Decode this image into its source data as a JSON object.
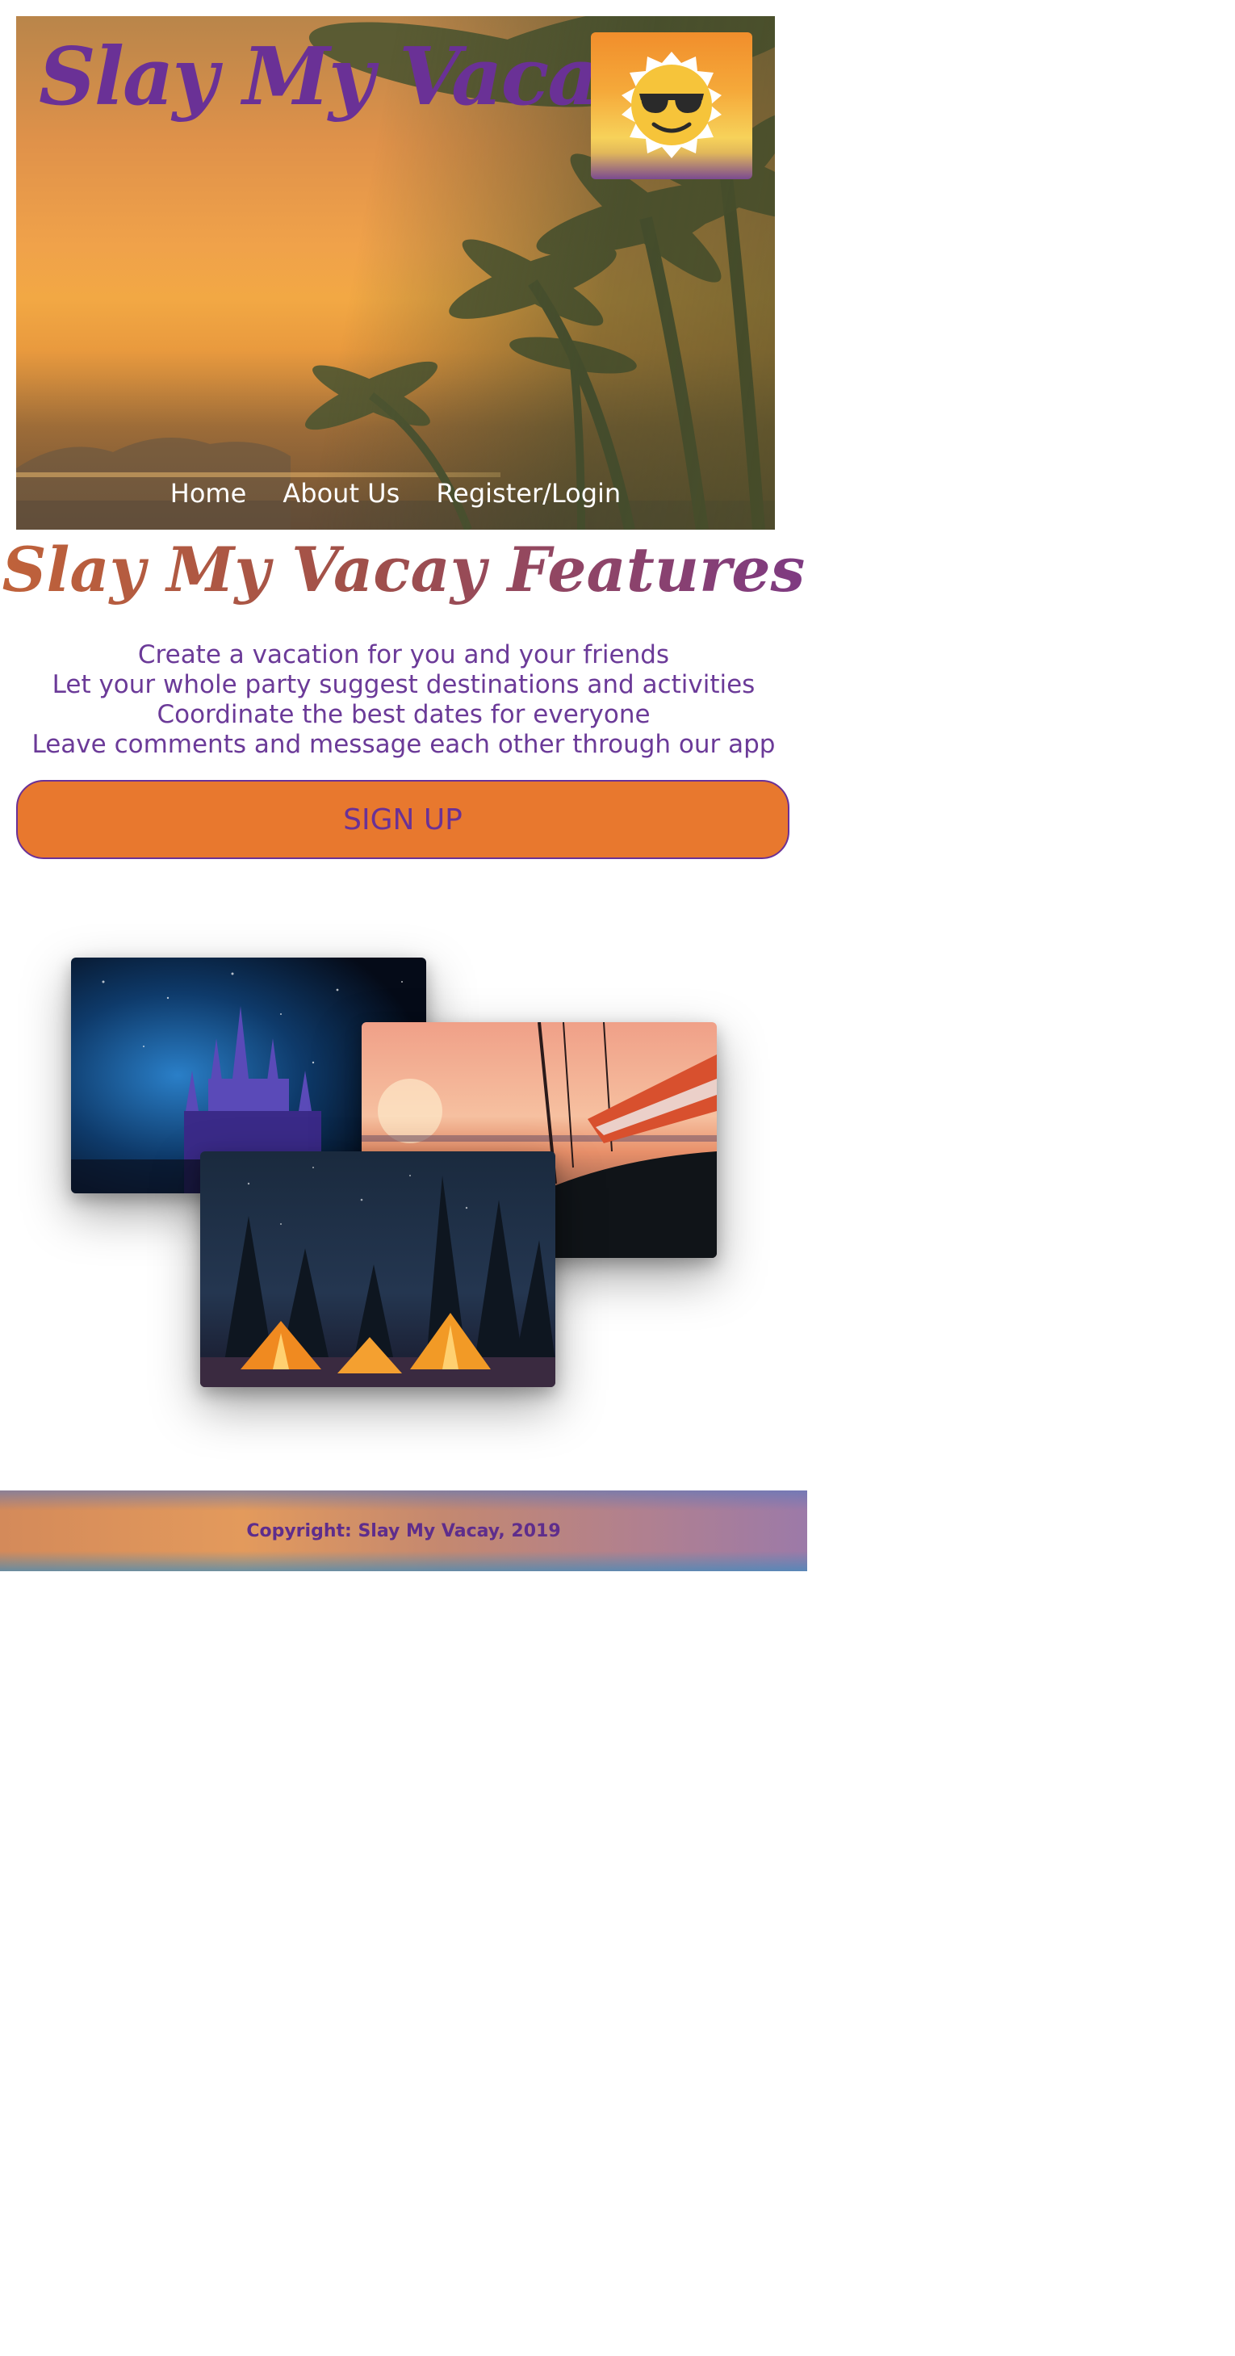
{
  "header": {
    "site_title": "Slay My Vacay",
    "logo_icon": "sun-with-sunglasses-icon"
  },
  "nav": {
    "items": [
      {
        "label": "Home"
      },
      {
        "label": "About Us"
      },
      {
        "label": "Register/Login"
      }
    ]
  },
  "features": {
    "title": "Slay My Vacay Features",
    "items": [
      "Create a vacation for you and your friends",
      "Let your whole party suggest destinations and activities",
      "Coordinate the best dates for everyone",
      "Leave comments and message each other through our app"
    ],
    "signup_label": "SIGN UP"
  },
  "gallery": {
    "images": [
      "castle-night-photo",
      "sailboat-sunset-photo",
      "tents-night-forest-photo"
    ]
  },
  "footer": {
    "copyright": "Copyright: Slay My Vacay, 2019"
  },
  "colors": {
    "brand_purple": "#6a3196",
    "accent_orange": "#e8782e",
    "text_purple": "#6b3a98"
  }
}
